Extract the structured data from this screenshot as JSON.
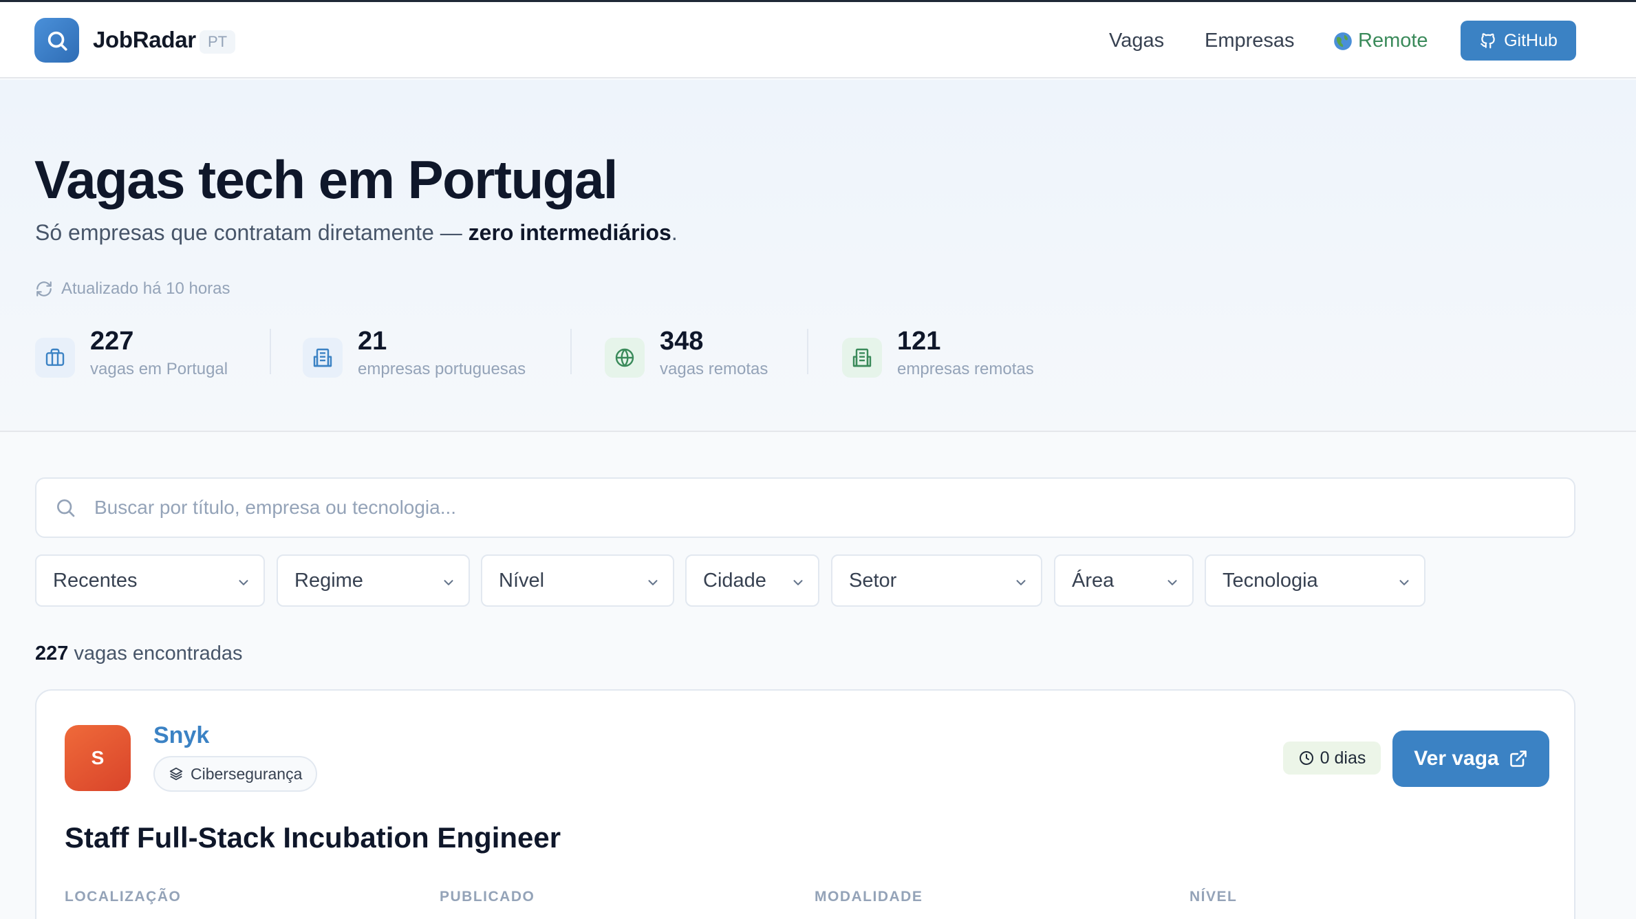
{
  "header": {
    "brand": "JobRadar",
    "badge": "PT",
    "nav": {
      "vagas": "Vagas",
      "empresas": "Empresas",
      "remote": "Remote",
      "github": "GitHub"
    }
  },
  "hero": {
    "title": "Vagas tech em Portugal",
    "subtitle_prefix": "Só empresas que contratam diretamente — ",
    "subtitle_bold": "zero intermediários",
    "subtitle_suffix": ".",
    "updated": "Atualizado há 10 horas",
    "stats": [
      {
        "value": "227",
        "label": "vagas em Portugal",
        "icon": "briefcase-icon"
      },
      {
        "value": "21",
        "label": "empresas portuguesas",
        "icon": "building-icon"
      },
      {
        "value": "348",
        "label": "vagas remotas",
        "icon": "globe-icon"
      },
      {
        "value": "121",
        "label": "empresas remotas",
        "icon": "building-icon"
      }
    ]
  },
  "search": {
    "placeholder": "Buscar por título, empresa ou tecnologia..."
  },
  "filters": {
    "sort": "Recentes",
    "regime": "Regime",
    "nivel": "Nível",
    "cidade": "Cidade",
    "setor": "Setor",
    "area": "Área",
    "tecnologia": "Tecnologia"
  },
  "results": {
    "count": "227",
    "label": " vagas encontradas"
  },
  "job": {
    "company_initial": "S",
    "company": "Snyk",
    "sector": "Cibersegurança",
    "age": "0 dias",
    "cta": "Ver vaga",
    "title": "Staff Full-Stack Incubation Engineer",
    "meta_labels": {
      "location": "LOCALIZAÇÃO",
      "published": "PUBLICADO",
      "mode": "MODALIDADE",
      "level": "NÍVEL"
    }
  },
  "colors": {
    "accent": "#3b82c4",
    "remote": "#3a8a5a",
    "company_logo": "#e0522f"
  }
}
